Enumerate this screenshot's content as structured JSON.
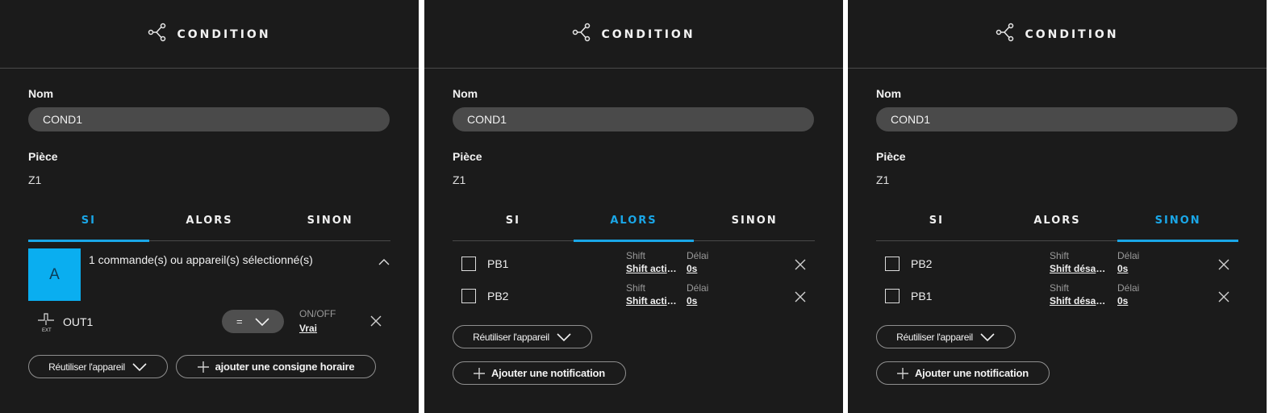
{
  "accent_color": "#1aa7e8",
  "panels": [
    {
      "header": {
        "icon": "branch-icon",
        "title": "CONDITION"
      },
      "name_label": "Nom",
      "name_value": "COND1",
      "room_label": "Pièce",
      "room_value": "Z1",
      "tabs": [
        {
          "label": "SI",
          "active": true
        },
        {
          "label": "ALORS",
          "active": false
        },
        {
          "label": "SINON",
          "active": false
        }
      ],
      "selection": {
        "box_letter": "A",
        "text": "1 commande(s) ou appareil(s) sélectionné(s)"
      },
      "condition_row": {
        "icon": "output-device-icon",
        "icon_caption": "EXT",
        "name": "OUT1",
        "operator": "=",
        "value_label": "ON/OFF",
        "value": "Vrai"
      },
      "buttons": {
        "reuse": "Réutiliser l'appareil",
        "add": "ajouter une consigne horaire"
      }
    },
    {
      "header": {
        "icon": "branch-icon",
        "title": "CONDITION"
      },
      "name_label": "Nom",
      "name_value": "COND1",
      "room_label": "Pièce",
      "room_value": "Z1",
      "tabs": [
        {
          "label": "SI",
          "active": false
        },
        {
          "label": "ALORS",
          "active": true
        },
        {
          "label": "SINON",
          "active": false
        }
      ],
      "rows": [
        {
          "name": "PB1",
          "shift_label": "Shift",
          "shift_value": "Shift activé",
          "delay_label": "Délai",
          "delay_value": "0s"
        },
        {
          "name": "PB2",
          "shift_label": "Shift",
          "shift_value": "Shift activé",
          "delay_label": "Délai",
          "delay_value": "0s"
        }
      ],
      "buttons": {
        "reuse": "Réutiliser l'appareil",
        "add": "Ajouter une notification"
      }
    },
    {
      "header": {
        "icon": "branch-icon",
        "title": "CONDITION"
      },
      "name_label": "Nom",
      "name_value": "COND1",
      "room_label": "Pièce",
      "room_value": "Z1",
      "tabs": [
        {
          "label": "SI",
          "active": false
        },
        {
          "label": "ALORS",
          "active": false
        },
        {
          "label": "SINON",
          "active": true
        }
      ],
      "rows": [
        {
          "name": "PB2",
          "shift_label": "Shift",
          "shift_value": "Shift désactivé",
          "delay_label": "Délai",
          "delay_value": "0s"
        },
        {
          "name": "PB1",
          "shift_label": "Shift",
          "shift_value": "Shift désactivé",
          "delay_label": "Délai",
          "delay_value": "0s"
        }
      ],
      "buttons": {
        "reuse": "Réutiliser l'appareil",
        "add": "Ajouter une notification"
      }
    }
  ]
}
